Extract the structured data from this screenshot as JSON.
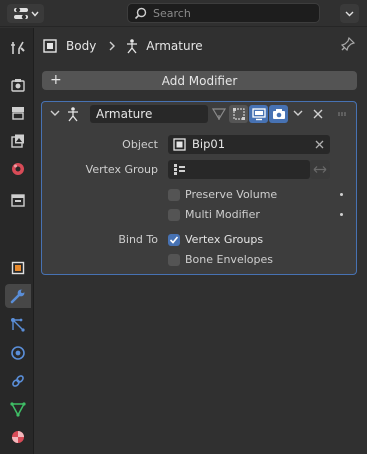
{
  "topbar": {
    "search_placeholder": "Search"
  },
  "breadcrumb": {
    "object": "Body",
    "modifier_data": "Armature"
  },
  "add_modifier_label": "Add Modifier",
  "modifier": {
    "name": "Armature",
    "object_label": "Object",
    "object_value": "Bip01",
    "vertex_group_label": "Vertex Group",
    "vertex_group_value": "",
    "preserve_volume_label": "Preserve Volume",
    "preserve_volume_checked": false,
    "multi_modifier_label": "Multi Modifier",
    "multi_modifier_checked": false,
    "bind_to_label": "Bind To",
    "vertex_groups_label": "Vertex Groups",
    "vertex_groups_checked": true,
    "bone_envelopes_label": "Bone Envelopes",
    "bone_envelopes_checked": false
  },
  "sidebar_tabs": [
    "tool-icon",
    "render-icon",
    "output-icon",
    "view-layer-icon",
    "scene-icon",
    "world-icon",
    "collection-icon",
    "object-icon",
    "modifier-icon",
    "particles-icon",
    "physics-icon",
    "constraints-icon",
    "data-icon",
    "material-icon"
  ],
  "colors": {
    "accent": "#4772b3",
    "background": "#303030",
    "panel": "#3d3d3d"
  }
}
